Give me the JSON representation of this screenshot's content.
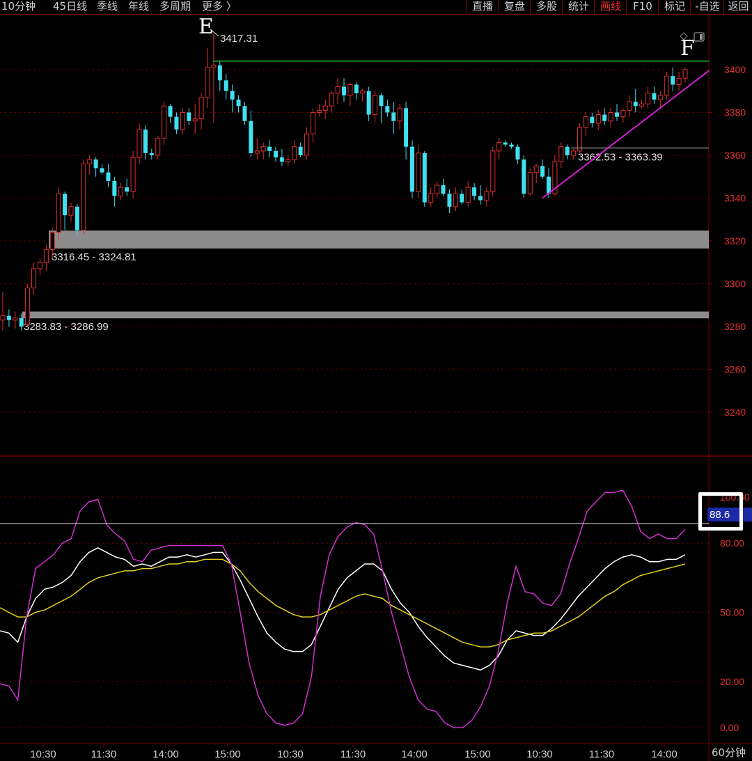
{
  "toolbar": {
    "periods": [
      "10分钟",
      "45日线",
      "季线",
      "年线",
      "多周期",
      "更多 〉"
    ],
    "buttons": [
      "直播",
      "复盘",
      "多股",
      "统计",
      "画线",
      "F10",
      "标记",
      "-自选",
      "返回"
    ],
    "active_button": "画线"
  },
  "colors": {
    "up": "#e03030",
    "down": "#40e0f0",
    "grid": "#7a0000",
    "axis_text": "#e03030",
    "resistance_line": "#20c020",
    "trend_line": "#d020d0",
    "zone_fill": "#8c8c8c",
    "kdj_k": "#ffffff",
    "kdj_d": "#e0d020",
    "kdj_j": "#d030d0"
  },
  "chart_data": [
    {
      "type": "candlestick",
      "title": "",
      "y_ticks": [
        3400,
        3380,
        3360,
        3340,
        3320,
        3300,
        3280,
        3260,
        3240
      ],
      "ylim": [
        3228,
        3432
      ],
      "x_ticks": [
        "10:30",
        "11:30",
        "14:00",
        "15:00",
        "10:30",
        "11:30",
        "14:00",
        "15:00",
        "10:30",
        "11:30",
        "14:00"
      ],
      "candles_ohlc": [
        [
          3283,
          3296,
          3278,
          3285
        ],
        [
          3285,
          3288,
          3280,
          3283
        ],
        [
          3283,
          3287,
          3279,
          3284
        ],
        [
          3284,
          3286,
          3278,
          3280
        ],
        [
          3281,
          3300,
          3280,
          3298
        ],
        [
          3298,
          3310,
          3295,
          3307
        ],
        [
          3307,
          3312,
          3304,
          3310
        ],
        [
          3310,
          3318,
          3306,
          3316
        ],
        [
          3316,
          3326,
          3312,
          3324
        ],
        [
          3324,
          3345,
          3320,
          3342
        ],
        [
          3342,
          3343,
          3325,
          3332
        ],
        [
          3332,
          3338,
          3329,
          3336
        ],
        [
          3336,
          3337,
          3322,
          3325
        ],
        [
          3325,
          3358,
          3323,
          3356
        ],
        [
          3356,
          3360,
          3351,
          3358
        ],
        [
          3358,
          3359,
          3350,
          3354
        ],
        [
          3354,
          3356,
          3351,
          3352
        ],
        [
          3352,
          3356,
          3345,
          3348
        ],
        [
          3348,
          3350,
          3336,
          3341
        ],
        [
          3341,
          3347,
          3339,
          3345
        ],
        [
          3345,
          3349,
          3341,
          3343
        ],
        [
          3343,
          3362,
          3340,
          3359
        ],
        [
          3359,
          3375,
          3356,
          3372
        ],
        [
          3372,
          3374,
          3358,
          3361
        ],
        [
          3361,
          3363,
          3358,
          3360
        ],
        [
          3360,
          3369,
          3358,
          3368
        ],
        [
          3368,
          3385,
          3365,
          3383
        ],
        [
          3383,
          3384,
          3375,
          3378
        ],
        [
          3378,
          3380,
          3370,
          3372
        ],
        [
          3372,
          3382,
          3370,
          3380
        ],
        [
          3380,
          3382,
          3374,
          3376
        ],
        [
          3376,
          3384,
          3370,
          3377
        ],
        [
          3377,
          3389,
          3372,
          3387
        ],
        [
          3387,
          3410,
          3382,
          3401
        ],
        [
          3401,
          3417,
          3375,
          3402
        ],
        [
          3402,
          3404,
          3390,
          3395
        ],
        [
          3395,
          3398,
          3386,
          3390
        ],
        [
          3390,
          3393,
          3380,
          3386
        ],
        [
          3386,
          3388,
          3380,
          3383
        ],
        [
          3383,
          3385,
          3374,
          3376
        ],
        [
          3376,
          3381,
          3359,
          3361
        ],
        [
          3361,
          3368,
          3358,
          3362
        ],
        [
          3362,
          3366,
          3358,
          3364
        ],
        [
          3364,
          3367,
          3359,
          3362
        ],
        [
          3362,
          3364,
          3357,
          3359
        ],
        [
          3359,
          3363,
          3355,
          3357
        ],
        [
          3357,
          3360,
          3355,
          3358
        ],
        [
          3358,
          3367,
          3356,
          3364
        ],
        [
          3364,
          3366,
          3359,
          3360
        ],
        [
          3360,
          3373,
          3358,
          3370
        ],
        [
          3370,
          3382,
          3366,
          3380
        ],
        [
          3380,
          3384,
          3378,
          3381
        ],
        [
          3381,
          3386,
          3377,
          3383
        ],
        [
          3383,
          3390,
          3380,
          3389
        ],
        [
          3389,
          3396,
          3384,
          3392
        ],
        [
          3392,
          3396,
          3385,
          3388
        ],
        [
          3388,
          3394,
          3383,
          3393
        ],
        [
          3393,
          3394,
          3386,
          3389
        ],
        [
          3389,
          3391,
          3385,
          3390
        ],
        [
          3390,
          3392,
          3376,
          3379
        ],
        [
          3379,
          3390,
          3375,
          3388
        ],
        [
          3388,
          3389,
          3375,
          3383
        ],
        [
          3383,
          3386,
          3378,
          3380
        ],
        [
          3380,
          3385,
          3370,
          3376
        ],
        [
          3376,
          3384,
          3372,
          3382
        ],
        [
          3382,
          3385,
          3358,
          3364
        ],
        [
          3364,
          3367,
          3340,
          3343
        ],
        [
          3343,
          3365,
          3340,
          3361
        ],
        [
          3361,
          3362,
          3336,
          3338
        ],
        [
          3338,
          3345,
          3336,
          3342
        ],
        [
          3342,
          3348,
          3340,
          3346
        ],
        [
          3346,
          3349,
          3341,
          3342
        ],
        [
          3342,
          3344,
          3333,
          3336
        ],
        [
          3336,
          3345,
          3334,
          3342
        ],
        [
          3342,
          3344,
          3337,
          3338
        ],
        [
          3338,
          3348,
          3336,
          3345
        ],
        [
          3345,
          3347,
          3339,
          3341
        ],
        [
          3341,
          3346,
          3337,
          3339
        ],
        [
          3339,
          3345,
          3336,
          3343
        ],
        [
          3343,
          3364,
          3341,
          3362
        ],
        [
          3362,
          3368,
          3358,
          3366
        ],
        [
          3366,
          3367,
          3364,
          3365
        ],
        [
          3365,
          3366,
          3363,
          3364
        ],
        [
          3364,
          3365,
          3356,
          3358
        ],
        [
          3358,
          3360,
          3340,
          3342
        ],
        [
          3342,
          3354,
          3341,
          3352
        ],
        [
          3352,
          3356,
          3347,
          3355
        ],
        [
          3355,
          3358,
          3349,
          3350
        ],
        [
          3350,
          3354,
          3340,
          3342
        ],
        [
          3342,
          3360,
          3341,
          3357
        ],
        [
          3357,
          3366,
          3354,
          3364
        ],
        [
          3364,
          3365,
          3358,
          3360
        ],
        [
          3360,
          3363,
          3358,
          3362
        ],
        [
          3362,
          3375,
          3361,
          3373
        ],
        [
          3373,
          3380,
          3369,
          3378
        ],
        [
          3378,
          3380,
          3373,
          3375
        ],
        [
          3375,
          3381,
          3372,
          3379
        ],
        [
          3379,
          3382,
          3374,
          3376
        ],
        [
          3376,
          3382,
          3373,
          3380
        ],
        [
          3380,
          3384,
          3376,
          3378
        ],
        [
          3378,
          3382,
          3375,
          3381
        ],
        [
          3381,
          3388,
          3378,
          3385
        ],
        [
          3385,
          3391,
          3380,
          3383
        ],
        [
          3383,
          3386,
          3382,
          3384
        ],
        [
          3384,
          3392,
          3382,
          3389
        ],
        [
          3389,
          3392,
          3384,
          3386
        ],
        [
          3386,
          3390,
          3382,
          3388
        ],
        [
          3388,
          3399,
          3386,
          3397
        ],
        [
          3397,
          3401,
          3390,
          3393
        ],
        [
          3393,
          3399,
          3390,
          3396
        ],
        [
          3396,
          3401,
          3394,
          3400
        ]
      ],
      "annotations": {
        "high_label": "3417.31",
        "letters": [
          "E",
          "F"
        ],
        "zones": [
          {
            "label": "3316.45 - 3324.81",
            "low": 3316.45,
            "high": 3324.81
          },
          {
            "label": "3283.83 - 3286.99",
            "low": 3283.83,
            "high": 3286.99
          }
        ],
        "level_line": {
          "label": "3362.53 - 3363.39",
          "value": 3363.39
        },
        "resistance": 3404,
        "trend_line": {
          "from_index": 87,
          "from_value": 3340,
          "to_value": 3399
        }
      }
    },
    {
      "type": "line",
      "title": "",
      "y_ticks": [
        "100.00",
        "80.00",
        "50.00",
        "20.00",
        "0.00"
      ],
      "ylim": [
        -5,
        110
      ],
      "current_value": "88.6",
      "series": [
        {
          "key": "K",
          "values": [
            42,
            41,
            37,
            48,
            56,
            60,
            61,
            63,
            66,
            72,
            76,
            78,
            76,
            74,
            73,
            70,
            71,
            70,
            72,
            74,
            74,
            75,
            74,
            75,
            76,
            76,
            71,
            64,
            56,
            48,
            41,
            37,
            34,
            33,
            33,
            36,
            44,
            52,
            60,
            65,
            68,
            71,
            71,
            68,
            60,
            54,
            50,
            44,
            39,
            35,
            31,
            28,
            27,
            26,
            25,
            27,
            31,
            38,
            42,
            41,
            40,
            40,
            43,
            47,
            52,
            57,
            61,
            65,
            69,
            72,
            74,
            75,
            74,
            72,
            72,
            73,
            73,
            75
          ]
        },
        {
          "key": "D",
          "values": [
            52,
            50,
            48,
            48,
            50,
            51,
            53,
            55,
            57,
            60,
            63,
            65,
            66,
            67,
            68,
            68,
            69,
            69,
            70,
            71,
            71,
            72,
            72,
            73,
            73,
            73,
            71,
            68,
            63,
            59,
            56,
            53,
            51,
            49,
            48,
            48,
            49,
            51,
            53,
            55,
            57,
            58,
            57,
            56,
            53,
            51,
            49,
            47,
            45,
            43,
            41,
            39,
            37,
            36,
            35,
            35,
            36,
            38,
            39,
            40,
            41,
            41,
            42,
            44,
            46,
            48,
            51,
            54,
            57,
            59,
            62,
            64,
            66,
            67,
            68,
            69,
            70,
            71
          ]
        },
        {
          "key": "J",
          "values": [
            19,
            18,
            12,
            48,
            69,
            72,
            75,
            80,
            82,
            94,
            98,
            99,
            88,
            84,
            81,
            73,
            72,
            77,
            78,
            79,
            79,
            79,
            79,
            79,
            79,
            79,
            71,
            50,
            28,
            14,
            6,
            2,
            1,
            2,
            6,
            22,
            57,
            75,
            83,
            87,
            89,
            88,
            84,
            68,
            50,
            36,
            22,
            12,
            8,
            7,
            2,
            0,
            0,
            3,
            9,
            18,
            33,
            54,
            70,
            59,
            58,
            54,
            53,
            58,
            71,
            82,
            94,
            98,
            102,
            102,
            103,
            96,
            85,
            82,
            84,
            82,
            82,
            86
          ]
        }
      ]
    }
  ],
  "bottom_period": "60分钟"
}
